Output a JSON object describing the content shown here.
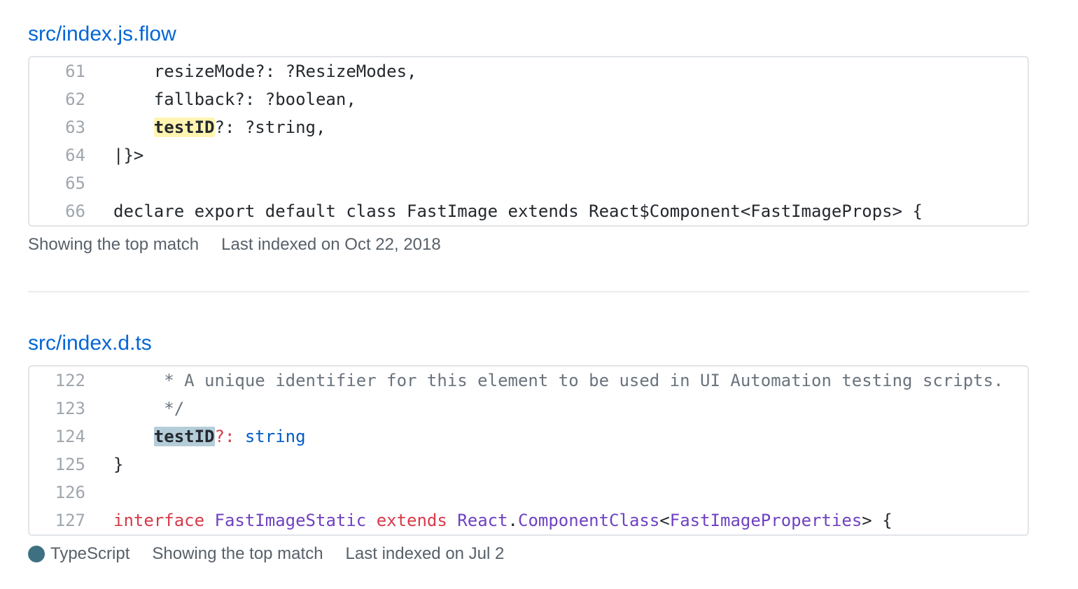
{
  "results": [
    {
      "file": "src/index.js.flow",
      "lines": [
        {
          "num": "61",
          "segments": [
            {
              "text": "    resizeMode?: ?ResizeModes,",
              "cls": "tok-plain"
            }
          ]
        },
        {
          "num": "62",
          "segments": [
            {
              "text": "    fallback?: ?boolean,",
              "cls": "tok-plain"
            }
          ]
        },
        {
          "num": "63",
          "segments": [
            {
              "text": "    ",
              "cls": "tok-plain"
            },
            {
              "text": "testID",
              "cls": "hl-yellow"
            },
            {
              "text": "?: ?string,",
              "cls": "tok-plain"
            }
          ]
        },
        {
          "num": "64",
          "segments": [
            {
              "text": "|}>",
              "cls": "tok-plain"
            }
          ]
        },
        {
          "num": "65",
          "segments": [
            {
              "text": "",
              "cls": "tok-plain"
            }
          ]
        },
        {
          "num": "66",
          "segments": [
            {
              "text": "declare export default class FastImage extends React$Component<FastImageProps> {",
              "cls": "tok-plain"
            }
          ]
        }
      ],
      "language": null,
      "match_text": "Showing the top match",
      "indexed_text": "Last indexed on Oct 22, 2018"
    },
    {
      "file": "src/index.d.ts",
      "lines": [
        {
          "num": "122",
          "segments": [
            {
              "text": "     * A unique identifier for this element to be used in UI Automation testing scripts.",
              "cls": "tok-comment"
            }
          ]
        },
        {
          "num": "123",
          "segments": [
            {
              "text": "     */",
              "cls": "tok-comment"
            }
          ]
        },
        {
          "num": "124",
          "segments": [
            {
              "text": "    ",
              "cls": "tok-plain"
            },
            {
              "text": "testID",
              "cls": "hl-blue"
            },
            {
              "text": "?:",
              "cls": "tok-keyword"
            },
            {
              "text": " string",
              "cls": "tok-builtin"
            }
          ]
        },
        {
          "num": "125",
          "segments": [
            {
              "text": "}",
              "cls": "tok-plain"
            }
          ]
        },
        {
          "num": "126",
          "segments": [
            {
              "text": "",
              "cls": "tok-plain"
            }
          ]
        },
        {
          "num": "127",
          "segments": [
            {
              "text": "interface",
              "cls": "tok-keyword"
            },
            {
              "text": " FastImageStatic ",
              "cls": "tok-type"
            },
            {
              "text": "extends",
              "cls": "tok-keyword"
            },
            {
              "text": " React",
              "cls": "tok-type"
            },
            {
              "text": ".",
              "cls": "tok-plain"
            },
            {
              "text": "ComponentClass",
              "cls": "tok-type"
            },
            {
              "text": "<",
              "cls": "tok-plain"
            },
            {
              "text": "FastImageProperties",
              "cls": "tok-type"
            },
            {
              "text": "> {",
              "cls": "tok-plain"
            }
          ]
        }
      ],
      "language": {
        "name": "TypeScript",
        "color": "#3f7082"
      },
      "match_text": "Showing the top match",
      "indexed_text": "Last indexed on Jul 2"
    }
  ]
}
